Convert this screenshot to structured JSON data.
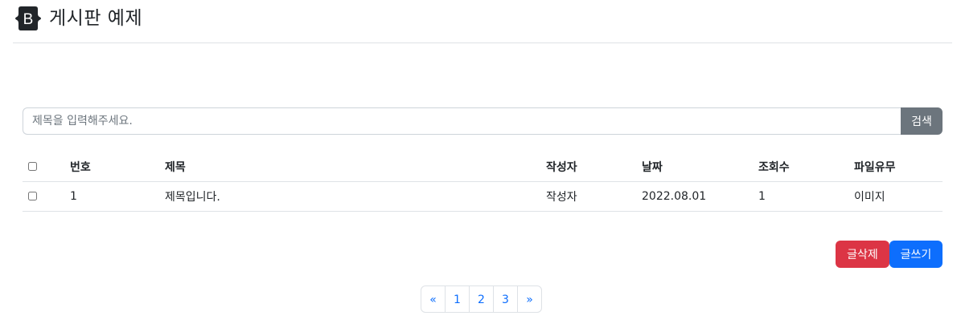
{
  "header": {
    "logo_letter": "B",
    "title": "게시판 예제"
  },
  "search": {
    "placeholder": "제목을 입력해주세요.",
    "value": "",
    "button_label": "검색"
  },
  "table": {
    "columns": [
      "번호",
      "제목",
      "작성자",
      "날짜",
      "조회수",
      "파일유무"
    ],
    "rows": [
      {
        "number": "1",
        "title": "제목입니다.",
        "author": "작성자",
        "date": "2022.08.01",
        "views": "1",
        "file": "이미지"
      }
    ]
  },
  "actions": {
    "delete_label": "글삭제",
    "write_label": "글쓰기"
  },
  "pagination": {
    "prev_label": "«",
    "pages": [
      "1",
      "2",
      "3"
    ],
    "next_label": "»"
  },
  "colors": {
    "logo": "#212529",
    "search_button": "#6c757d",
    "delete_button": "#dc3545",
    "write_button": "#0d6efd",
    "page_link": "#0d6efd",
    "border": "#dee2e6"
  },
  "icons": {
    "logo": "bootstrap-logo-icon"
  }
}
